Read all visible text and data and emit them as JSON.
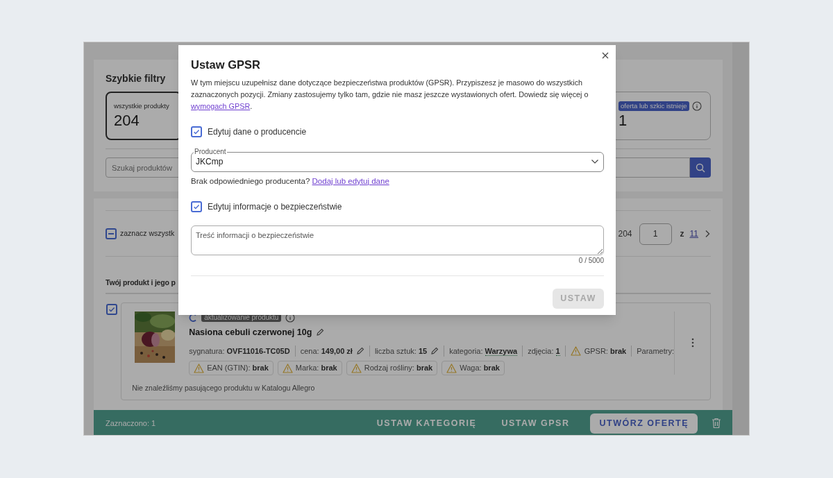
{
  "quick_filters": {
    "title": "Szybkie filtry",
    "tiles": [
      {
        "label": "wszystkie produkty",
        "count": "204",
        "selected": true,
        "kind": "plain"
      },
      {
        "label": "oferta lub szkic istnieje",
        "count": "1",
        "selected": false,
        "kind": "badge"
      }
    ]
  },
  "search": {
    "placeholder": "Szukaj produktów"
  },
  "list": {
    "select_all": {
      "label": "zaznacz wszystk",
      "indeterminate": true
    },
    "pagination": {
      "total": "204",
      "page": "1",
      "of": "z",
      "pages": "11"
    },
    "section_title": "Twój produkt i jego p",
    "product": {
      "selected": true,
      "status": "aktualizowanie produktu",
      "name": "Nasiona cebuli czerwonej 10g",
      "meta": [
        {
          "label": "sygnatura:",
          "value": "OVF11016-TC05D",
          "kind": "plain",
          "editable": false,
          "warning": false
        },
        {
          "label": "cena:",
          "value": "149,00 zł",
          "kind": "plain",
          "editable": true,
          "warning": false
        },
        {
          "label": "liczba sztuk:",
          "value": "15",
          "kind": "plain",
          "editable": true,
          "warning": false
        },
        {
          "label": "kategoria:",
          "value": "Warzywa",
          "kind": "link",
          "editable": false,
          "warning": false
        },
        {
          "label": "zdjęcia:",
          "value": "1",
          "kind": "link",
          "editable": false,
          "warning": false
        },
        {
          "label": "GPSR:",
          "value": "brak",
          "kind": "plain",
          "editable": false,
          "warning": true
        },
        {
          "label": "Parametry:",
          "kind": "label",
          "editable": false,
          "warning": false
        }
      ],
      "tags": [
        {
          "label": "EAN (GTIN):",
          "value": "brak"
        },
        {
          "label": "Marka:",
          "value": "brak"
        },
        {
          "label": "Rodzaj rośliny:",
          "value": "brak"
        },
        {
          "label": "Waga:",
          "value": "brak"
        }
      ],
      "note": "Nie znaleźliśmy pasującego produktu w Katalogu Allegro"
    }
  },
  "bulk_bar": {
    "selected_text": "Zaznaczono: 1",
    "actions": [
      {
        "label": "USTAW KATEGORIĘ",
        "kind": "text"
      },
      {
        "label": "USTAW GPSR",
        "kind": "text"
      },
      {
        "label": "UTWÓRZ OFERTĘ",
        "kind": "primary"
      }
    ]
  },
  "dialog": {
    "title": "Ustaw GPSR",
    "intro": "W tym miejscu uzupełnisz dane dotyczące bezpieczeństwa produktów (GPSR). Przypiszesz je masowo do wszystkich zaznaczonych pozycji. Zmiany zastosujemy tylko tam, gdzie nie masz jeszcze wystawionych ofert. Dowiedz się więcej o ",
    "intro_link": "wymogach GPSR",
    "intro_end": ".",
    "producer_checkbox": {
      "label": "Edytuj dane o producencie",
      "checked": true
    },
    "producer_select": {
      "label": "Producent",
      "value": "JKCmp"
    },
    "hint": "Brak odpowiedniego producenta?",
    "hint_link": "Dodaj lub edytuj dane",
    "safety_checkbox": {
      "label": "Edytuj informacje o bezpieczeństwie",
      "checked": true
    },
    "safety_text": {
      "placeholder": "Treść informacji o bezpieczeństwie",
      "counter": "0 / 5000"
    },
    "submit": {
      "label": "USTAW",
      "disabled": true
    }
  }
}
